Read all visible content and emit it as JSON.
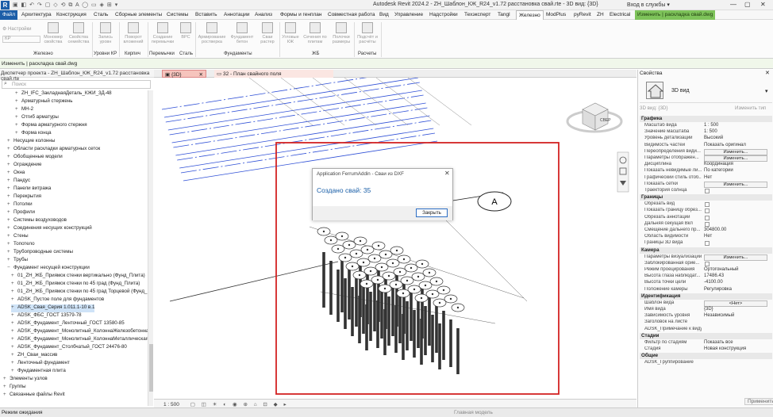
{
  "titlebar": {
    "logo": "R",
    "quick_access": "▣ ◧ ↶ ↷ ▢ ◇ ⟲ ⧉ A ◯ ▭ ◈ ⊞ ▾",
    "title": "Autodesk Revit 2024.2 - ZH_Шаблон_КЖ_R24_v1.72 расстановка свай.rte - 3D вид: {3D}",
    "signin": "Вход в службы ▾",
    "win": [
      "—",
      "▢",
      "✕"
    ]
  },
  "menu": {
    "file": "Файл",
    "items": [
      "Архитектура",
      "Конструкция",
      "Сталь",
      "Сборные элементы",
      "Системы",
      "Вставить",
      "Аннотации",
      "Анализ",
      "Формы и генплан",
      "Совместная работа",
      "Вид",
      "Управление",
      "Надстройки",
      "Техэксперт",
      "Tangl",
      "Железно",
      "ModPlus",
      "pyRevit",
      "ZH",
      "Electrical"
    ],
    "contextual": "Изменить | раскладка свай.dwg"
  },
  "ribbon": {
    "settings": "Настройки",
    "kr": "КР",
    "buttons": [
      "Мономер свойства",
      "Свойства семейства",
      "Запись уровн",
      "Поворот вложений",
      "Создание перемычки",
      "BPC",
      "Армирование ростверка",
      "Фундамент бетон",
      "Сваи растер",
      "Угловые КЖ",
      "Сечения по плитам",
      "Полочки размеры",
      "Подсчёт и расчёты"
    ],
    "groups": [
      "Железно",
      "Уровни КР",
      "Кирпич",
      "Перемычки",
      "Сталь",
      "Фундаменты",
      "ЖБ",
      "Расчеты"
    ]
  },
  "options_bar": "Изменить | раскладка свай.dwg",
  "project_browser": {
    "title": "Диспетчер проекта - ZH_Шаблон_КЖ_R24_v1.72 расстановка свай.rte",
    "search_placeholder": "Поиск",
    "items": [
      {
        "t": "+",
        "label": "ZH_IFC_ЗакладнаяДеталь_КЖИ_3Д-48"
      },
      {
        "t": "+",
        "label": "Арматурный стержень"
      },
      {
        "t": "+",
        "label": "МН-2"
      },
      {
        "t": "+",
        "label": "Отгиб арматуры"
      },
      {
        "t": "+",
        "label": "Форма арматурного стержня"
      },
      {
        "t": "+",
        "label": "Форма конца"
      },
      {
        "t": "+",
        "label": "Несущие колонны"
      },
      {
        "t": "+",
        "label": "Области раскладки арматурных сеток"
      },
      {
        "t": "+",
        "label": "Обобщенные модели"
      },
      {
        "t": "+",
        "label": "Ограждение"
      },
      {
        "t": "+",
        "label": "Окна"
      },
      {
        "t": "+",
        "label": "Пандус"
      },
      {
        "t": "+",
        "label": "Панели витража"
      },
      {
        "t": "+",
        "label": "Перекрытия"
      },
      {
        "t": "+",
        "label": "Потолки"
      },
      {
        "t": "+",
        "label": "Профили"
      },
      {
        "t": "+",
        "label": "Системы воздуховодов"
      },
      {
        "t": "+",
        "label": "Соединения несущих конструкций"
      },
      {
        "t": "+",
        "label": "Стены"
      },
      {
        "t": "+",
        "label": "Топотело"
      },
      {
        "t": "+",
        "label": "Трубопроводные системы"
      },
      {
        "t": "+",
        "label": "Трубы"
      },
      {
        "t": "−",
        "label": "Фундамент несущей конструкции"
      },
      {
        "t": "+",
        "label": "01_ZH_ЖБ_Приямок стенки вертикально (Фунд_Плита)"
      },
      {
        "t": "+",
        "label": "01_ZH_ЖБ_Приямок стенки по 45 град (Фунд_Плита)"
      },
      {
        "t": "+",
        "label": "01_ZH_ЖБ_Приямок стенки по 45 град Торцевой (Фунд_"
      },
      {
        "t": "+",
        "label": "ADSK_Пустое поле для фундаментов"
      },
      {
        "t": "+",
        "label": "ADSK_Свая_Серия 1.011.1-10 в.1"
      },
      {
        "t": "+",
        "label": "ADSK_ФБС_ГОСТ 13579-78"
      },
      {
        "t": "+",
        "label": "ADSK_Фундамент_Ленточный_ГОСТ 13580-85"
      },
      {
        "t": "+",
        "label": "ADSK_Фундамент_Монолитный_КолоннаЖелезобетонна"
      },
      {
        "t": "+",
        "label": "ADSK_Фундамент_Монолитный_КолоннаМеталлическая"
      },
      {
        "t": "+",
        "label": "ADSK_Фундамент_Столбчатый_ГОСТ 24476-80"
      },
      {
        "t": "+",
        "label": "ZH_Сваи_массив"
      },
      {
        "t": "+",
        "label": "Ленточный фундамент"
      },
      {
        "t": "+",
        "label": "Фундаментная плита"
      },
      {
        "t": "+",
        "label": "Элементы узлов"
      },
      {
        "t": "+",
        "label": "Группы"
      },
      {
        "t": "+",
        "label": "Связанные файлы Revit"
      }
    ]
  },
  "tabs": [
    {
      "label": "{3D}"
    },
    {
      "label": "32 - План свайного поля"
    }
  ],
  "viewport": {
    "section_label": "A",
    "cube_label": "СВЕР",
    "scale": "1 : 500"
  },
  "dialog": {
    "title": "Application FerrumAddin - Сваи из DXF",
    "message": "Создано свай: 35",
    "close": "Закрыть"
  },
  "properties": {
    "header": "Свойства",
    "type_name": "3D вид",
    "filter": "3D вид: {3D}",
    "edit_type": "Изменить тип",
    "sections": [
      {
        "name": "Графика",
        "rows": [
          {
            "k": "Масштаб вида",
            "v": "1 : 500"
          },
          {
            "k": "Значение масштаба",
            "v": "1:   500"
          },
          {
            "k": "Уровень детализации",
            "v": "Высокий"
          },
          {
            "k": "Видимость частей",
            "v": "Показать оригинал"
          },
          {
            "k": "Переопределения види...",
            "btn": "Изменить..."
          },
          {
            "k": "Параметры отображен...",
            "btn": "Изменить..."
          },
          {
            "k": "Дисциплина",
            "v": "Координация"
          },
          {
            "k": "Показать невидимые ли...",
            "v": "По категории"
          },
          {
            "k": "Графический стиль отоб...",
            "v": "Нет"
          },
          {
            "k": "Показать сетки",
            "btn": "Изменить..."
          },
          {
            "k": "Траектория солнца",
            "chk": true
          }
        ]
      },
      {
        "name": "Границы",
        "rows": [
          {
            "k": "Обрезать вид",
            "chk": true
          },
          {
            "k": "Показать границу обрез...",
            "chk": true
          },
          {
            "k": "Обрезать аннотации",
            "chk": true
          },
          {
            "k": "Дальняя секущая Вкл",
            "chk": true
          },
          {
            "k": "Смещение дальнего пр...",
            "v": "304800.00"
          },
          {
            "k": "Область видимости",
            "v": "Нет"
          },
          {
            "k": "Границы 3D вида",
            "chk": true
          }
        ]
      },
      {
        "name": "Камера",
        "rows": [
          {
            "k": "Параметры визуализации",
            "btn": "Изменить..."
          },
          {
            "k": "Заблокированная ориe...",
            "chk": true
          },
          {
            "k": "Режим проецирования",
            "v": "Ортогональный"
          },
          {
            "k": "Высота глаза наблюдат...",
            "v": "17486.43"
          },
          {
            "k": "Высота точки цели",
            "v": "-4100.00"
          },
          {
            "k": "Положение камеры",
            "v": "Регулировка"
          }
        ]
      },
      {
        "name": "Идентификация",
        "rows": [
          {
            "k": "Шаблон вида",
            "btn": "<Нет>"
          },
          {
            "k": "Имя вида",
            "v": "{3D}"
          },
          {
            "k": "Зависимость уровня",
            "v": "Независимый"
          },
          {
            "k": "Заголовок на листе",
            "v": ""
          },
          {
            "k": "ADSK_Примечание к виду",
            "v": ""
          }
        ]
      },
      {
        "name": "Стадии",
        "rows": [
          {
            "k": "Фильтр по стадиям",
            "v": "Показать все"
          },
          {
            "k": "Стадия",
            "v": "Новая конструкция"
          }
        ]
      },
      {
        "name": "Общие",
        "rows": [
          {
            "k": "ADSK_Группирование",
            "v": ""
          }
        ]
      }
    ],
    "apply": "Применить"
  },
  "status": {
    "left": "Режим ожидания",
    "model": "Главная модель"
  }
}
